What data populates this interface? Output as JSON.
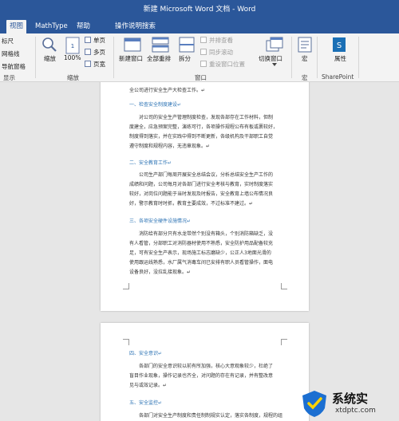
{
  "window": {
    "title": "新建 Microsoft Word 文档 - Word"
  },
  "tabs": [
    {
      "label": "视图"
    },
    {
      "label": "MathType"
    },
    {
      "label": "帮助"
    },
    {
      "label": "操作说明搜索"
    }
  ],
  "ribbon": {
    "show_group": {
      "ruler": "标尺",
      "gridlines": "网格线",
      "nav_pane": "导航窗格",
      "label": "显示"
    },
    "zoom_group": {
      "zoom": "缩放",
      "zoom_pct": "100%",
      "one_page": "单页",
      "multi_page": "多页",
      "page_width": "页宽",
      "label": "缩放"
    },
    "window_group": {
      "new_window": "新建窗口",
      "arrange_all": "全部重排",
      "split": "拆分",
      "side_by_side": "并排查看",
      "sync_scroll": "同步滚动",
      "reset_pos": "重设窗口位置",
      "switch_window": "切换窗口",
      "label": "窗口"
    },
    "macro_group": {
      "macros": "宏",
      "label": "宏"
    },
    "sharepoint_group": {
      "properties": "属性",
      "label": "SharePoint"
    }
  },
  "page1": {
    "lines": [
      "全公司进行安全生产大检查工作。↵",
      "一、检查安全制度建设↵",
      "对公司的安全生产管理制度检查，发现各部存在工作材料，但制",
      "度建全，应急预案完整，演练可行，各项操作规程公布有板或裹较好，",
      "制度得到落实，并在实践中得到不断更新，各级机构及干部职工自觉",
      "遵守制度和规程内容，无违章现象。↵",
      "二、安全教育工作↵",
      "公司生产部门每周开展安全总结会议，分析总结安全生产工作的",
      "成绩和问题，公司每月对各部门进行安全考核与教育，实时制度落实",
      "较好，对岗位问题能于当时发现及时报告，安全教育上墙公布情况良",
      "好，警示教育时时抓，教育主要成效，不过标准不建过。↵",
      "三、各项安全硬件设施情况↵",
      "消防给有部分只有水龙带然个别没有箱头，个别消防箱缺乏，没",
      "有人看管，分部职工对消防器材使用不熟悉，安全防护用品配备较充",
      "足，可有安全生产表示，现场施工标志磨缺少，公正人3地面光滑的",
      "使用跟运线熟悉，水厂属气消毒车间已安排有职人员看管操作，面电",
      "设备良好，没拉乱接现象。↵"
    ]
  },
  "page2": {
    "lines": [
      "四、安全意识↵",
      "各部门的安全意识较以前有所加强，核心大意观象较少，杜绝了",
      "盲目作业现象，操作记录也齐全，对问题的存在有记录，并有整改意",
      "见与或效记录。↵",
      "五、安全监控↵",
      "各部门对安全生产制度和责任制制规实认定，落实各制度，规程的组"
    ]
  },
  "watermark": {
    "brand": "系统实",
    "site": "xtdptc.com"
  }
}
